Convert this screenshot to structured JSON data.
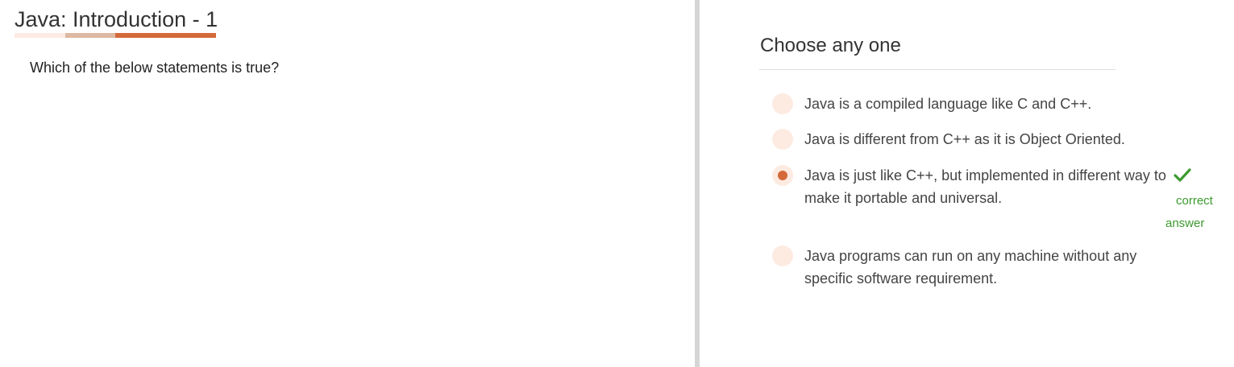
{
  "quiz": {
    "title": "Java: Introduction - 1",
    "question": "Which of the below statements is true?"
  },
  "answer_panel": {
    "heading": "Choose any one",
    "options": [
      {
        "label": "Java is a compiled language like C and C++.",
        "selected": false
      },
      {
        "label": "Java is different from C++ as it is Object Oriented.",
        "selected": false
      },
      {
        "label": "Java is just like C++, but implemented in different way to make it portable and universal.",
        "selected": true
      },
      {
        "label": "Java programs can run on any machine without any specific software requirement.",
        "selected": false
      }
    ],
    "feedback": {
      "icon": "checkmark-icon",
      "text": "correct answer"
    }
  },
  "colors": {
    "accent": "#d4693a",
    "accent_light": "#ddb9a2",
    "accent_pale": "#fdebe2",
    "radio_bg": "#fdebe2",
    "correct_green": "#3c9a2f",
    "divider": "#d6d6d6"
  }
}
